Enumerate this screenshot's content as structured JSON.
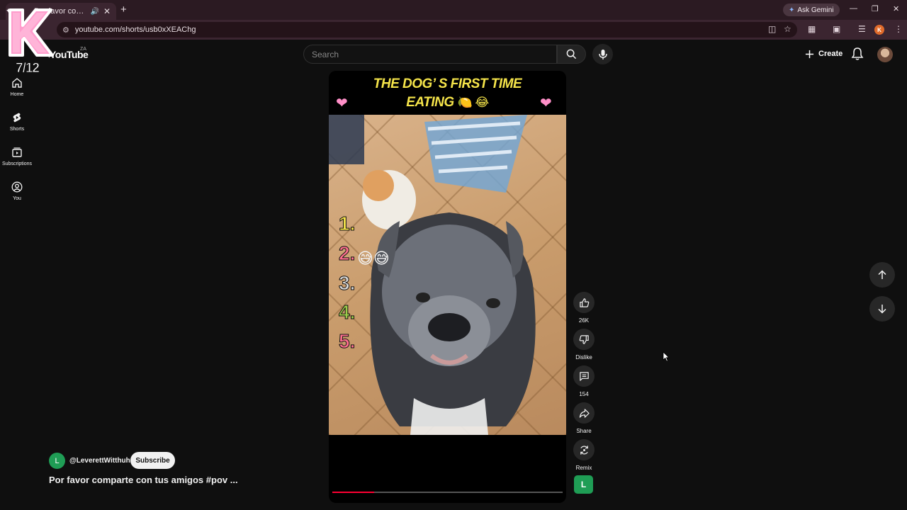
{
  "browser": {
    "tab_title": "Por favor comparte con tus",
    "new_tab_symbol": "+",
    "ask_gemini": "Ask Gemini",
    "url": "youtube.com/shorts/usb0xXEAChg",
    "profile_initial": "K"
  },
  "overlay": {
    "sticker_letter": "K",
    "counter": "7/12"
  },
  "header": {
    "logo_text": "YouTube",
    "region": "ZA",
    "search_placeholder": "Search",
    "create_label": "Create"
  },
  "sidebar": {
    "items": [
      {
        "label": "Home",
        "icon": "home-icon"
      },
      {
        "label": "Shorts",
        "icon": "shorts-icon"
      },
      {
        "label": "Subscriptions",
        "icon": "subscriptions-icon"
      },
      {
        "label": "You",
        "icon": "you-icon"
      }
    ]
  },
  "video": {
    "title_line1": "THE DOG’ S FIRST TIME",
    "title_line2": "EATING",
    "title_emojis": "🍋 😂",
    "ranking": [
      "1.",
      "2.",
      "3.",
      "4.",
      "5."
    ],
    "ranking_colors": [
      "#f5e44a",
      "#ff6f8f",
      "#d8d8d8",
      "#9ccc4a",
      "#ff6f8f"
    ],
    "rank2_emojis": "😅😅",
    "progress_fraction": 0.18
  },
  "actions": {
    "like_count": "26K",
    "dislike_label": "Dislike",
    "comment_count": "154",
    "share_label": "Share",
    "remix_label": "Remix",
    "channel_initial": "L"
  },
  "channel": {
    "avatar_initial": "L",
    "handle": "@LeverettWitthuhn",
    "subscribe_label": "Subscribe",
    "description": "Por favor comparte con tus amigos #pov ..."
  },
  "colors": {
    "accent": "#ff0033",
    "channel_green": "#1f9d55"
  }
}
